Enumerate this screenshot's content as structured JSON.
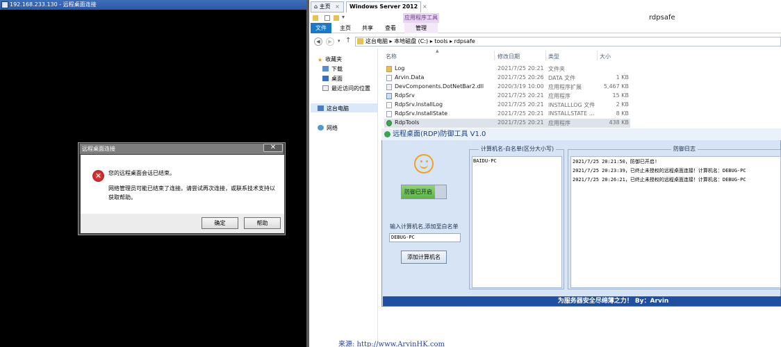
{
  "rdp": {
    "title": "192.168.233.130 - 远程桌面连接"
  },
  "dialog": {
    "title": "远程桌面连接",
    "close": "✕",
    "message1": "您的远程桌面会话已结束。",
    "message2": "网络管理员可能已结束了连接。请尝试再次连接，或联系技术支持以获取帮助。",
    "ok": "确定",
    "help": "帮助"
  },
  "explorer": {
    "tabs": [
      "主页",
      "Windows Server 2012"
    ],
    "tab_close": "×",
    "app_tools": "应用程序工具",
    "window_title": "rdpsafe",
    "ribbon_tabs": [
      "文件",
      "主页",
      "共享",
      "查看",
      "管理"
    ],
    "address": "这台电脑  ▸  本地磁盘 (C:)  ▸  tools  ▸  rdpsafe",
    "nav": {
      "favorites": "收藏夹",
      "downloads": "下载",
      "desktop": "桌面",
      "recent": "最近访问的位置",
      "this_pc": "这台电脑",
      "network": "网络"
    },
    "columns": [
      "名称",
      "修改日期",
      "类型",
      "大小"
    ],
    "files": [
      {
        "name": "Log",
        "date": "2021/7/25 20:21",
        "type": "文件夹",
        "size": ""
      },
      {
        "name": "Arvin.Data",
        "date": "2021/7/25 20:26",
        "type": "DATA 文件",
        "size": "1 KB"
      },
      {
        "name": "DevComponents.DotNetBar2.dll",
        "date": "2020/3/19 10:00",
        "type": "应用程序扩展",
        "size": "5,467 KB"
      },
      {
        "name": "RdpSrv",
        "date": "2021/7/25 20:21",
        "type": "应用程序",
        "size": "15 KB"
      },
      {
        "name": "RdpSrv.InstallLog",
        "date": "2021/7/25 20:21",
        "type": "INSTALLLOG 文件",
        "size": "2 KB"
      },
      {
        "name": "RdpSrv.InstallState",
        "date": "2021/7/25 20:21",
        "type": "INSTALLSTATE ...",
        "size": "8 KB"
      },
      {
        "name": "RdpTools",
        "date": "2021/7/25 20:21",
        "type": "应用程序",
        "size": "438 KB"
      }
    ]
  },
  "app": {
    "title": "远程桌面(RDP)防御工具 V1.0",
    "toggle_label": "防御已开启",
    "input_label": "输入计算机名,添加至白名单",
    "input_value": "DEBUG-PC",
    "add_button": "添加计算机名",
    "whitelist_title": "计算机名-白名单(区分大小写)",
    "whitelist": [
      "BAIDU-PC"
    ],
    "log_title": "防御日志",
    "logs": [
      "2021/7/25  20:21:50，防御已开启!",
      "2021/7/25  20:23:39，已终止未授权的远程桌面连接！计算机名：DEBUG-PC",
      "2021/7/25  20:26:21，已终止未授权的远程桌面连接！计算机名：DEBUG-PC"
    ],
    "footer": "为服务器安全尽绵薄之力！ By：Arvin"
  },
  "source_text": "来源: http://www.ArvinHK.com"
}
